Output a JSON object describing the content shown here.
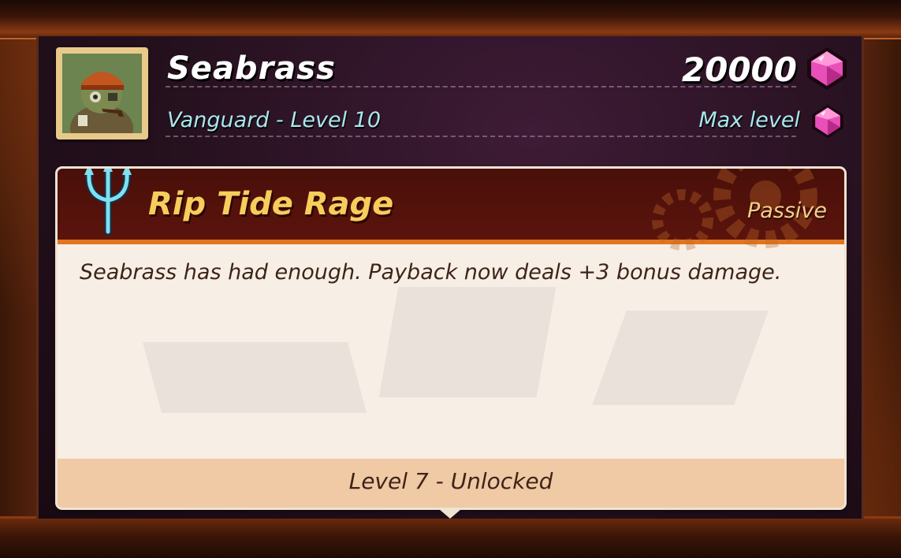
{
  "hero": {
    "name": "Seabrass",
    "subtitle": "Vanguard - Level 10",
    "portrait_icon": "seabrass-portrait"
  },
  "upgrade": {
    "cost": "20000",
    "cost_icon": "gem-icon",
    "status": "Max level",
    "status_icon": "gem-icon"
  },
  "skill": {
    "icon": "trident-icon",
    "name": "Rip Tide Rage",
    "type": "Passive",
    "description": "Seabrass has had enough. Payback now deals +3 bonus damage.",
    "unlock": "Level 7 - Unlocked"
  },
  "colors": {
    "panel": "#24101d",
    "header": "#4a0f0a",
    "accent_orange": "#e2751f",
    "skill_title": "#f7cd5b",
    "subtitle": "#a9e6ee",
    "gem": "#e84fb8"
  }
}
